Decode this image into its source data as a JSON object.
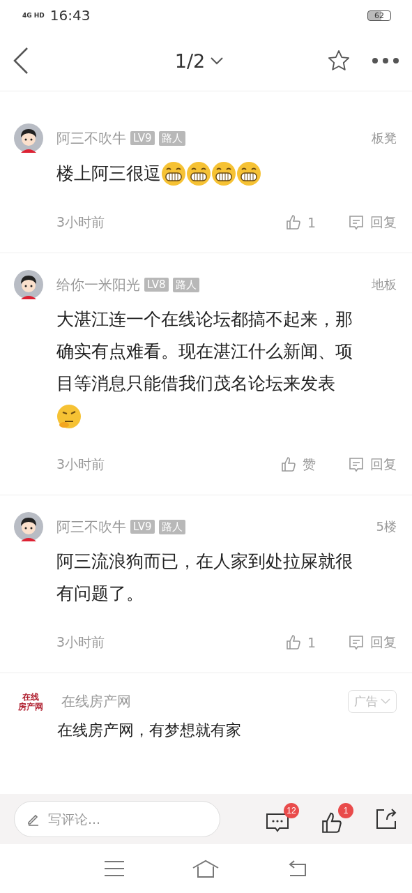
{
  "status_bar": {
    "network": "4G HD",
    "time": "16:43",
    "battery": "62"
  },
  "header": {
    "page": "1/2"
  },
  "comments": [
    {
      "user": "阿三不吹牛",
      "level": "LV9",
      "role": "路人",
      "floor": "板凳",
      "text": "楼上阿三很逗",
      "emojis": [
        {
          "kind": "grin"
        },
        {
          "kind": "grin"
        },
        {
          "kind": "grin"
        },
        {
          "kind": "grin"
        }
      ],
      "time": "3小时前",
      "likes": "1",
      "reply": "回复"
    },
    {
      "user": "给你一米阳光",
      "level": "LV8",
      "role": "路人",
      "floor": "地板",
      "text": "大湛江连一个在线论坛都搞不起来，那确实有点难看。现在湛江什么新闻、项目等消息只能借我们茂名论坛来发表",
      "emojis": [
        {
          "kind": "thinking"
        }
      ],
      "time": "3小时前",
      "likes": "赞",
      "reply": "回复"
    },
    {
      "user": "阿三不吹牛",
      "level": "LV9",
      "role": "路人",
      "floor": "5楼",
      "text": "阿三流浪狗而已，在人家到处拉屎就很有问题了。",
      "time": "3小时前",
      "likes": "1",
      "reply": "回复"
    }
  ],
  "ad": {
    "logo": [
      "在线",
      "房产网"
    ],
    "name": "在线房产网",
    "tag": "广告",
    "text": "在线房产网，有梦想就有家"
  },
  "bottom_bar": {
    "placeholder": "写评论...",
    "comment_count": "12",
    "like_count": "1"
  }
}
